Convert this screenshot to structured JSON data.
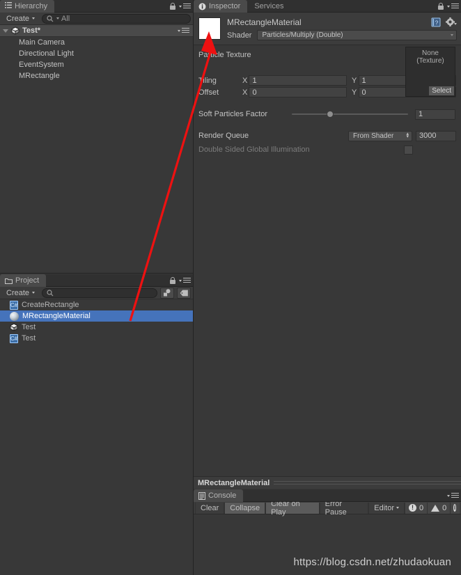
{
  "hierarchy": {
    "tab_label": "Hierarchy",
    "tab_icon": "hierarchy-icon",
    "create_label": "Create",
    "search_placeholder": "All",
    "search_value": "All",
    "scene_name": "Test*",
    "items": [
      {
        "label": "Main Camera"
      },
      {
        "label": "Directional Light"
      },
      {
        "label": "EventSystem"
      },
      {
        "label": "MRectangle"
      }
    ]
  },
  "project": {
    "tab_label": "Project",
    "create_label": "Create",
    "search_value": "",
    "items": [
      {
        "label": "CreateRectangle",
        "icon": "csharp-script-icon",
        "selected": false
      },
      {
        "label": "MRectangleMaterial",
        "icon": "material-icon",
        "selected": true
      },
      {
        "label": "Test",
        "icon": "unity-scene-icon",
        "selected": false
      },
      {
        "label": "Test",
        "icon": "csharp-script-icon",
        "selected": false
      }
    ]
  },
  "inspector": {
    "tabs": [
      {
        "label": "Inspector",
        "active": true
      },
      {
        "label": "Services",
        "active": false
      }
    ],
    "material_name": "MRectangleMaterial",
    "shader_label": "Shader",
    "shader_value": "Particles/Multiply (Double)",
    "particle_texture_label": "Particle Texture",
    "texture_slot": {
      "line1": "None",
      "line2": "(Texture)",
      "select_label": "Select"
    },
    "tiling": {
      "label": "Tiling",
      "x_axis": "X",
      "x_value": "1",
      "y_axis": "Y",
      "y_value": "1"
    },
    "offset": {
      "label": "Offset",
      "x_axis": "X",
      "x_value": "0",
      "y_axis": "Y",
      "y_value": "0"
    },
    "soft_particles": {
      "label": "Soft Particles Factor",
      "value": "1",
      "slider_percent": 33
    },
    "render_queue": {
      "label": "Render Queue",
      "mode": "From Shader",
      "value": "3000"
    },
    "double_sided_gi": {
      "label": "Double Sided Global Illumination",
      "checked": false
    }
  },
  "preview_bar": {
    "title": "MRectangleMaterial"
  },
  "console": {
    "tab_label": "Console",
    "buttons": [
      {
        "label": "Clear",
        "active": false
      },
      {
        "label": "Collapse",
        "active": true
      },
      {
        "label": "Clear on Play",
        "active": true
      },
      {
        "label": "Error Pause",
        "active": false
      },
      {
        "label": "Editor",
        "active": false,
        "has_caret": true
      }
    ],
    "counters": [
      {
        "icon": "error-icon",
        "count": "0"
      },
      {
        "icon": "warning-icon",
        "count": "0"
      }
    ]
  },
  "watermark": {
    "text": "https://blog.csdn.net/zhudaokuan"
  },
  "annotation": {
    "arrow_color": "#ee1111"
  },
  "colors": {
    "panel_bg": "#383838",
    "header_bg": "#3c3c3c",
    "selection_blue": "#4573bb",
    "border": "#232323",
    "text": "#b9b9b9"
  }
}
